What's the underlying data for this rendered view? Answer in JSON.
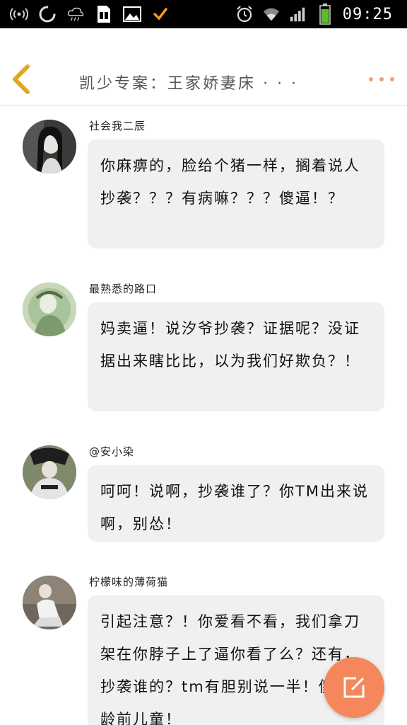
{
  "status_bar": {
    "time": "09:25",
    "icons": [
      "hotspot-icon",
      "sync-icon",
      "weather-icon",
      "document-icon",
      "image-icon",
      "check-icon",
      "alarm-icon",
      "wifi-icon",
      "signal-icon",
      "battery-icon"
    ]
  },
  "header": {
    "title": "凯少专案：王家娇妻床 · · ·"
  },
  "comments": [
    {
      "username": "社会我二辰",
      "text": "你麻痹的，脸给个猪一样，搁着说人抄袭？？？有病嘛？？？傻逼！？"
    },
    {
      "username": "最熟悉的路口",
      "text": "妈卖逼！说汐爷抄袭？证据呢？没证据出来瞎比比，以为我们好欺负？！"
    },
    {
      "username": "@安小染",
      "text": "呵呵！说啊，抄袭谁了？你TM出来说啊，别怂！"
    },
    {
      "username": "柠檬味的薄荷猫",
      "text": "引起注意？！你爱看不看，我们拿刀架在你脖子上了逼你看了么？还有，抄袭谁的？tm有胆别说一半！傻逼学龄前儿童！"
    }
  ],
  "colors": {
    "accent": "#f4885c",
    "back_arrow": "#e2a81c",
    "bubble": "#f0f0f0"
  }
}
